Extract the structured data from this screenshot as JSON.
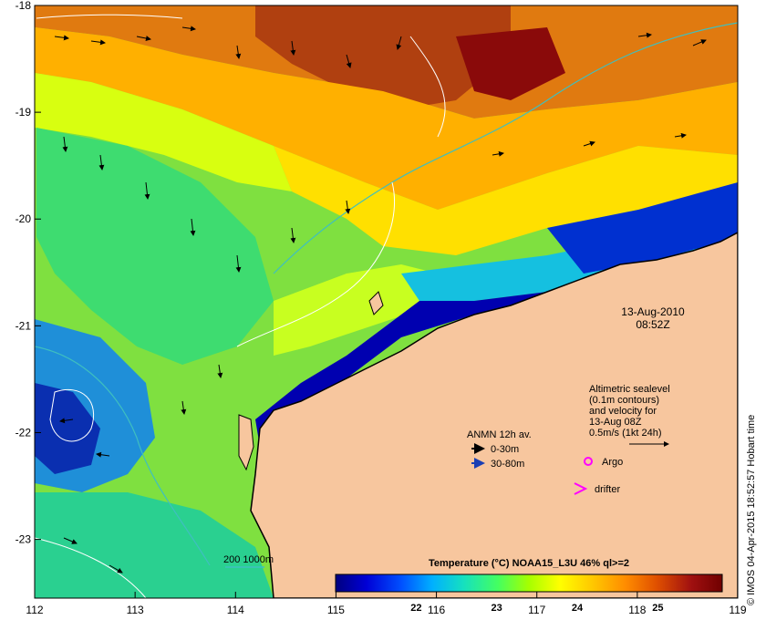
{
  "map": {
    "lon_ticks": [
      "112",
      "113",
      "114",
      "115",
      "116",
      "117",
      "118",
      "119"
    ],
    "lat_ticks": [
      "-18",
      "-19",
      "-20",
      "-21",
      "-22",
      "-23"
    ],
    "lon_range": [
      112,
      119
    ],
    "lat_range": [
      -23.55,
      -18
    ],
    "date": "13-Aug-2010",
    "time": "08:52Z",
    "altimetry_label": [
      "Altimetric sealevel",
      "(0.1m contours)",
      "and velocity for",
      "13-Aug 08Z"
    ],
    "velocity_scale_label": "0.5m/s (1kt 24h)",
    "anmn": {
      "title": "ANMN 12h av.",
      "items": [
        {
          "label": "0-30m",
          "color": "#000000"
        },
        {
          "label": "30-80m",
          "color": "#1a3fb4"
        }
      ]
    },
    "argo_label": "Argo",
    "drifter_label": "drifter",
    "marker_color": "#ff00ff",
    "isobath_label": "200  1000m",
    "isobath_color": "#3fbfbf",
    "credit": "© IMOS 04-Apr-2015 18:52:57 Hobart time",
    "colors": {
      "land": "#f7c69e",
      "coast": "#000000"
    }
  },
  "colorbar": {
    "title": "Temperature (°C) NOAA15_L3U 46% ql>=2",
    "ticks": [
      "22",
      "23",
      "24",
      "25"
    ],
    "tick_values": [
      22,
      23,
      24,
      25
    ],
    "range": [
      21.0,
      25.8
    ],
    "colors": [
      "#00007f",
      "#0000d6",
      "#0050ff",
      "#00b0ff",
      "#15e0c0",
      "#44ff60",
      "#a6ff00",
      "#ffff00",
      "#ffc400",
      "#ff8c00",
      "#e05000",
      "#a01010",
      "#700000"
    ]
  }
}
